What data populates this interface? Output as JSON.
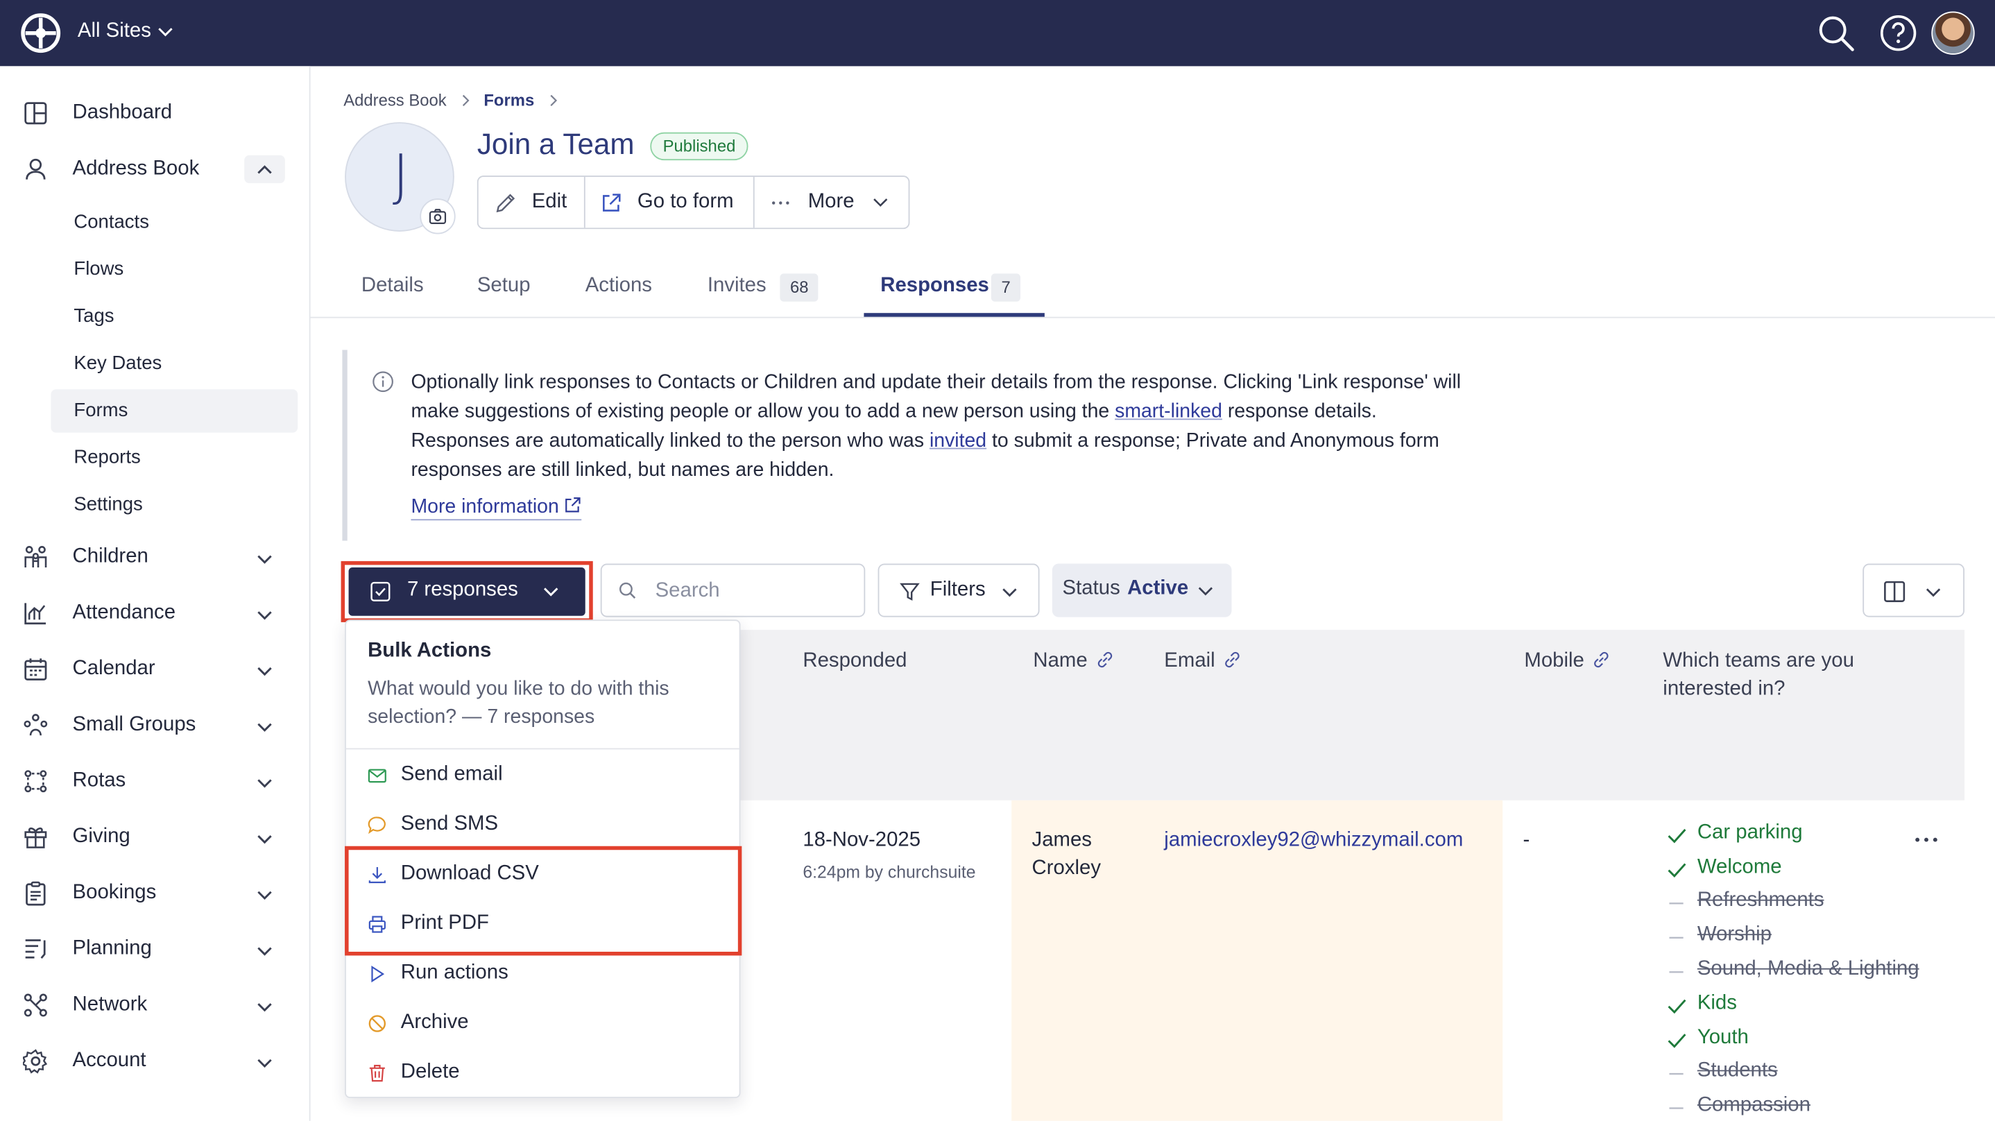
{
  "topbar": {
    "site_selector": "All Sites"
  },
  "sidebar": {
    "items": [
      {
        "label": "Dashboard"
      },
      {
        "label": "Address Book"
      },
      {
        "label": "Children"
      },
      {
        "label": "Attendance"
      },
      {
        "label": "Calendar"
      },
      {
        "label": "Small Groups"
      },
      {
        "label": "Rotas"
      },
      {
        "label": "Giving"
      },
      {
        "label": "Bookings"
      },
      {
        "label": "Planning"
      },
      {
        "label": "Network"
      },
      {
        "label": "Account"
      }
    ],
    "address_book_sub": [
      "Contacts",
      "Flows",
      "Tags",
      "Key Dates",
      "Forms",
      "Reports",
      "Settings"
    ]
  },
  "breadcrumb": {
    "items": [
      "Address Book",
      "Forms"
    ]
  },
  "page": {
    "avatar_letter": "J",
    "title": "Join a Team",
    "status_badge": "Published",
    "actions": {
      "edit": "Edit",
      "go_to_form": "Go to form",
      "more": "More"
    }
  },
  "tabs": [
    {
      "label": "Details",
      "count": ""
    },
    {
      "label": "Setup",
      "count": ""
    },
    {
      "label": "Actions",
      "count": ""
    },
    {
      "label": "Invites",
      "count": "68"
    },
    {
      "label": "Responses",
      "count": "7"
    }
  ],
  "info": {
    "p1": "Optionally link responses to Contacts or Children and update their details from the response. Clicking 'Link response' will make suggestions of existing people or allow you to add a new person using the ",
    "link1": "smart-linked",
    "p2": " response details. Responses are automatically linked to the person who was ",
    "link2": "invited",
    "p3": " to submit a response; Private and Anonymous form responses are still linked, but names are hidden.",
    "more": "More information"
  },
  "toolbar": {
    "responses_button": "7 responses",
    "search_placeholder": "Search",
    "filters": "Filters",
    "status_label": "Status",
    "status_value": "Active"
  },
  "bulk_menu": {
    "title": "Bulk Actions",
    "description": "What would you like to do with this selection? — 7 responses",
    "items": [
      "Send email",
      "Send SMS",
      "Download CSV",
      "Print PDF",
      "Run actions",
      "Archive",
      "Delete"
    ]
  },
  "table": {
    "headers": [
      "Responded",
      "Name",
      "Email",
      "Mobile",
      "Which teams are you interested in?"
    ],
    "rows": [
      {
        "responded_date": "18-Nov-2025",
        "responded_meta": "6:24pm by churchsuite",
        "name": "James Croxley",
        "email": "jamiecroxley92@whizzymail.com",
        "mobile": "-",
        "teams": [
          {
            "label": "Car parking",
            "selected": true
          },
          {
            "label": "Welcome",
            "selected": true
          },
          {
            "label": "Refreshments",
            "selected": false
          },
          {
            "label": "Worship",
            "selected": false
          },
          {
            "label": "Sound, Media & Lighting",
            "selected": false
          },
          {
            "label": "Kids",
            "selected": true
          },
          {
            "label": "Youth",
            "selected": true
          },
          {
            "label": "Students",
            "selected": false
          },
          {
            "label": "Compassion",
            "selected": false
          }
        ]
      }
    ]
  },
  "colors": {
    "navy": "#262b4f",
    "accent": "#2e3a7a",
    "highlight": "#e2412e",
    "success": "#1e7a3a"
  }
}
